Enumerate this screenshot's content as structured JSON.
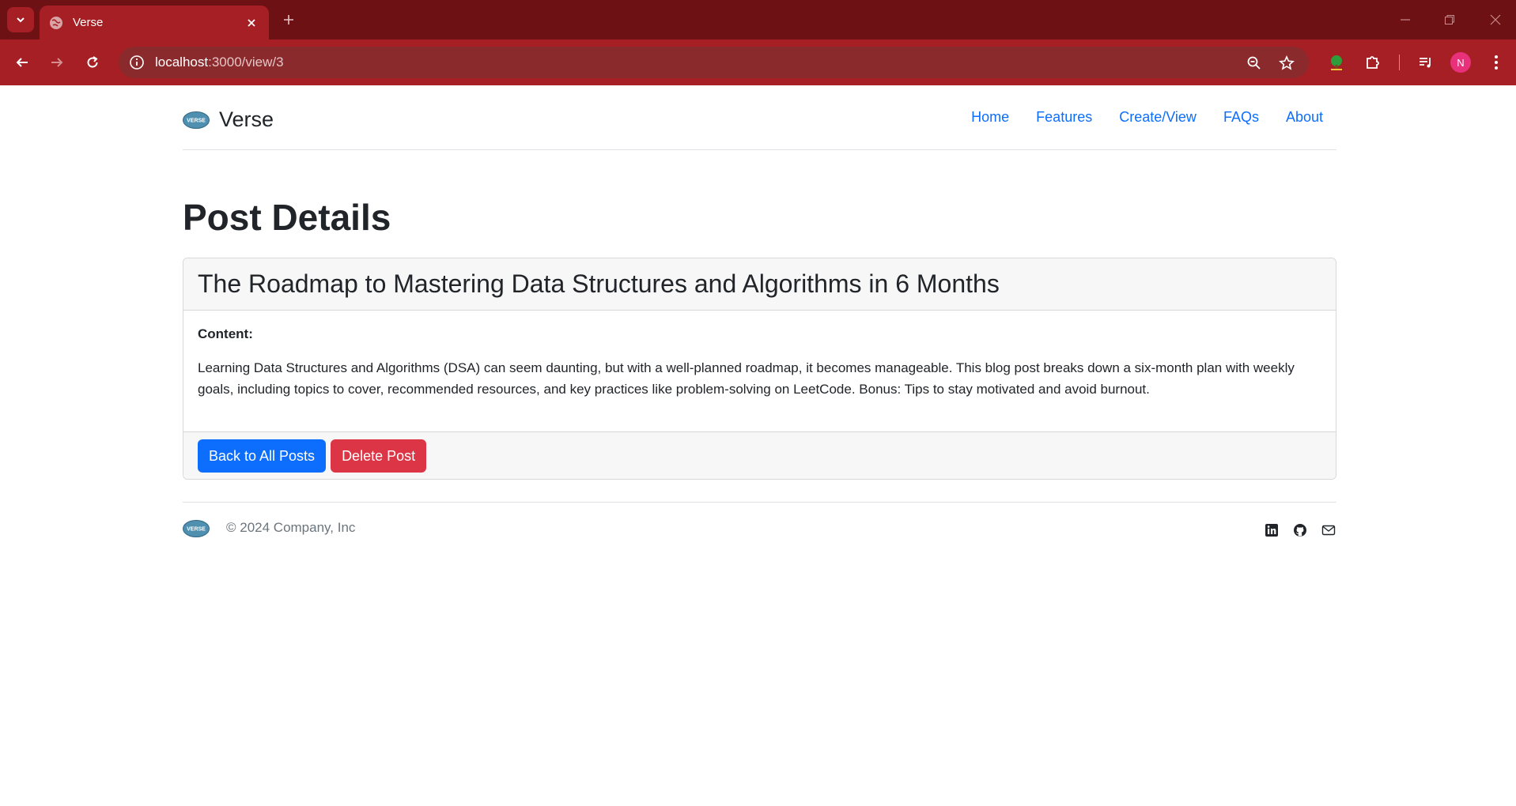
{
  "browser": {
    "tab": {
      "title": "Verse"
    },
    "url": {
      "host": "localhost",
      "path": ":3000/view/3"
    },
    "profile_initial": "N"
  },
  "site": {
    "brand": "Verse",
    "logo_text": "VERSE",
    "nav": [
      "Home",
      "Features",
      "Create/View",
      "FAQs",
      "About"
    ]
  },
  "page": {
    "title": "Post Details"
  },
  "post": {
    "title": "The Roadmap to Mastering Data Structures and Algorithms in 6 Months",
    "content_label": "Content:",
    "content": "Learning Data Structures and Algorithms (DSA) can seem daunting, but with a well-planned roadmap, it becomes manageable. This blog post breaks down a six-month plan with weekly goals, including topics to cover, recommended resources, and key practices like problem-solving on LeetCode. Bonus: Tips to stay motivated and avoid burnout."
  },
  "actions": {
    "back_label": "Back to All Posts",
    "delete_label": "Delete Post"
  },
  "footer": {
    "copyright": "© 2024 Company, Inc",
    "social_icons": [
      "linkedin-icon",
      "github-icon",
      "mail-icon"
    ]
  },
  "colors": {
    "browser_accent": "#a51f24",
    "primary": "#0d6efd",
    "danger": "#dc3545"
  }
}
